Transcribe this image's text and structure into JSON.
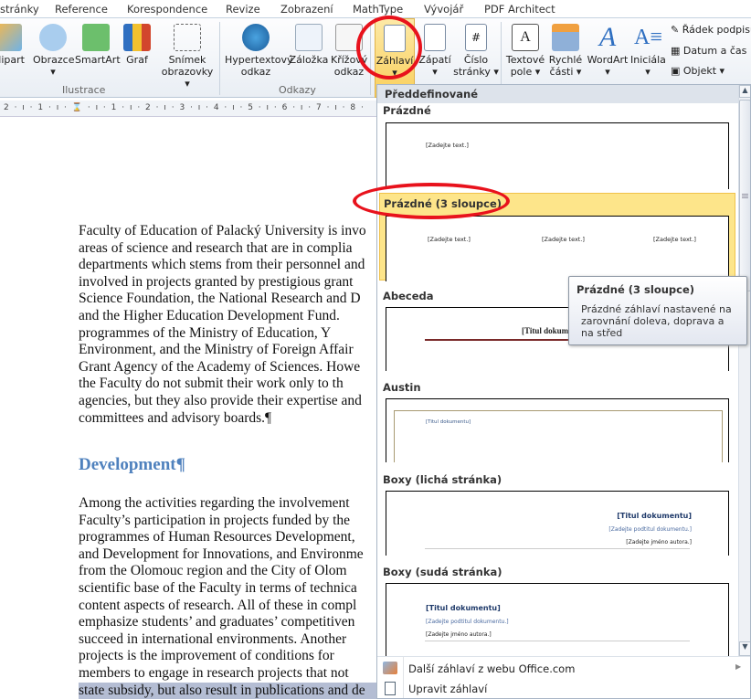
{
  "ribbon_tabs": [
    "stránky",
    "Reference",
    "Korespondence",
    "Revize",
    "Zobrazení",
    "MathType",
    "Vývojář",
    "PDF Architect"
  ],
  "ribbon": {
    "buttons": [
      "Klipart",
      "Obrazce",
      "SmartArt",
      "Graf",
      "Snímek obrazovky",
      "Hypertextový odkaz",
      "Záložka",
      "Křížový odkaz",
      "Záhlaví",
      "Zápatí",
      "Číslo stránky",
      "Textové pole",
      "Rychlé části",
      "WordArt",
      "Iniciála"
    ],
    "small_buttons": [
      "Řádek podpisu",
      "Datum a čas",
      "Objekt"
    ],
    "groups": [
      "Ilustrace",
      "Odkazy"
    ]
  },
  "ruler": "2 · ı · 1 · ı · ⌛ · ı · 1 · ı · 2 · ı · 3 · ı · 4 · ı · 5 · ı · 6 · ı · 7 · ı · 8 ·",
  "document": {
    "para1": [
      "Faculty of Education of Palacký University is invo",
      "areas of science and research that are in complia",
      "departments which stems from their personnel and",
      "involved in projects granted by prestigious grant",
      "Science Foundation, the National Research and D",
      "and the Higher Education Development Fund.",
      "programmes of the Ministry of Education, Y",
      "Environment, and the Ministry of Foreign Affair",
      "Grant Agency of the Academy of Sciences. Howe",
      "the Faculty do not submit their work only to th",
      "agencies, but they also provide their expertise and",
      "committees and advisory boards.¶"
    ],
    "heading": "Development¶",
    "para2": [
      "Among the activities regarding the involvement",
      "Faculty’s participation in projects funded by the",
      "programmes of Human Resources Development,",
      "and Development for Innovations, and Environme",
      "from the Olomouc region and the City of Olom",
      "scientific base of the Faculty in terms of technica",
      "content aspects of research. All of these in compl",
      "emphasize students’ and graduates’ competitiven",
      "succeed in international environments. Another",
      "projects is the improvement of conditions for",
      "members to engage in research projects that not",
      "state subsidy, but also result in publications and de"
    ]
  },
  "gallery": {
    "header": "Předdefinované",
    "items": [
      {
        "label": "Prázdné",
        "placeholders": [
          "[Zadejte text.]"
        ]
      },
      {
        "label": "Prázdné (3 sloupce)",
        "placeholders": [
          "[Zadejte text.]",
          "[Zadejte text.]",
          "[Zadejte text.]"
        ],
        "selected": true
      },
      {
        "label": "Abeceda",
        "placeholders": [
          "[Titul dokumentu]"
        ]
      },
      {
        "label": "Austin",
        "placeholders": [
          "[Titul dokumentu]"
        ]
      },
      {
        "label": "Boxy (lichá stránka)",
        "placeholders": [
          "[Titul dokumentu]",
          "[Zadejte podtitul dokumentu.]",
          "[Zadejte jméno autora.]"
        ]
      },
      {
        "label": "Boxy (sudá stránka)",
        "placeholders": [
          "[Titul dokumentu]",
          "[Zadejte podtitul dokumentu.]",
          "[Zadejte jméno autora.]"
        ]
      }
    ],
    "menu": [
      "Další záhlaví z webu Office.com",
      "Upravit záhlaví"
    ]
  },
  "tooltip": {
    "title": "Prázdné (3 sloupce)",
    "body": "Prázdné záhlaví nastavené na zarovnání doleva, doprava a na střed"
  },
  "colors": {
    "accent_highlight": "#fde58a",
    "annotation": "#e8121c",
    "heading": "#4f81bd"
  }
}
